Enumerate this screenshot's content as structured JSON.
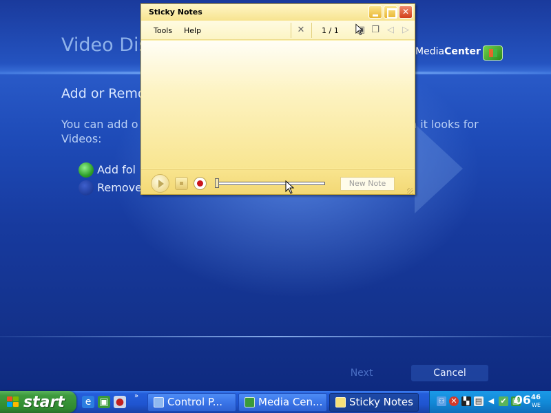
{
  "media_center": {
    "title": "Video Dis",
    "section_title": "Add or Remo",
    "description_line1_start": "You can add o",
    "description_line1_end": "n it looks for",
    "description_line2": "Videos:",
    "options": [
      "Add fol",
      "Remove"
    ],
    "brand": {
      "media": "Media",
      "center": "Center"
    },
    "buttons": {
      "next": "Next",
      "cancel": "Cancel"
    }
  },
  "sticky_notes": {
    "title": "Sticky Notes",
    "menu": {
      "tools": "Tools",
      "help": "Help"
    },
    "page_indicator": "1 / 1",
    "toolbar_icons": [
      "delete-icon",
      "paste-icon",
      "copy-icon",
      "previous-icon",
      "next-icon"
    ],
    "new_note_label": "New Note",
    "colors": {
      "note": "#fbeea6",
      "record": "#c9161c"
    }
  },
  "taskbar": {
    "start_label": "start",
    "quick_launch": [
      "internet-explorer-icon",
      "media-center-icon",
      "media-player-icon"
    ],
    "more_label": "»",
    "tasks": [
      {
        "label": "Control P...",
        "active": false
      },
      {
        "label": "Media Cen...",
        "active": false
      },
      {
        "label": "Sticky Notes",
        "active": true
      }
    ],
    "clock": {
      "hour": "06",
      "minute": "46",
      "day": "WE"
    }
  }
}
